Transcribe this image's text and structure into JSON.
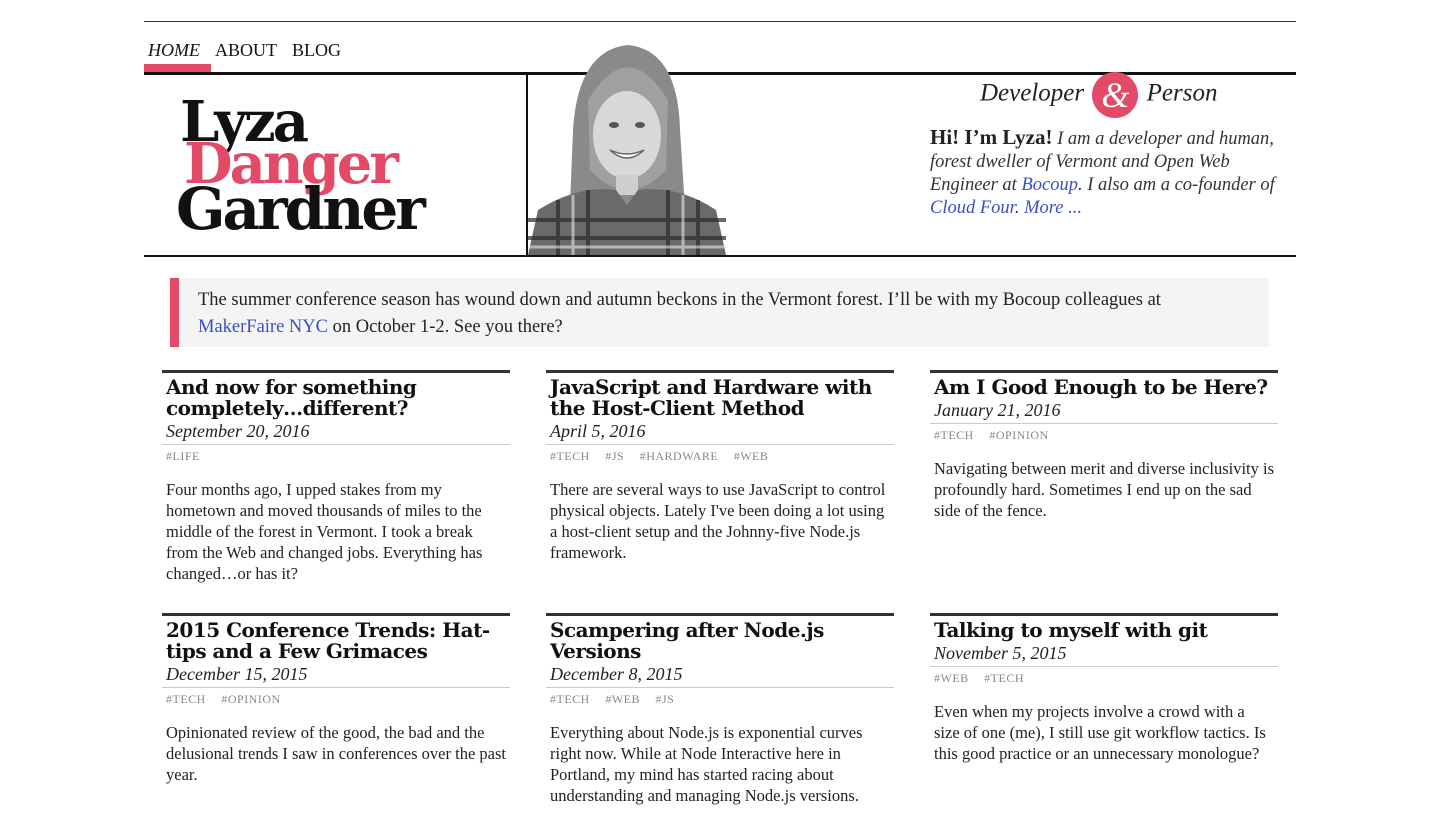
{
  "nav": {
    "items": [
      {
        "label": "HOME",
        "active": true
      },
      {
        "label": "ABOUT"
      },
      {
        "label": "BLOG"
      }
    ]
  },
  "logo": {
    "line1": "Lyza",
    "line2": "Danger",
    "line3": "Gardner"
  },
  "tagline": {
    "left": "Developer",
    "amp": "&",
    "right": "Person"
  },
  "intro": {
    "hi": "Hi! I’m Lyza!",
    "text1": "I am a developer and human, forest dweller of Vermont and Open Web Engineer at",
    "link1": "Bocoup",
    "text2": ". I also am a co-founder of",
    "link2": "Cloud Four",
    "text3": ".",
    "more": "More ..."
  },
  "notice": {
    "text1": "The summer conference season has wound down and autumn beckons in the Vermont forest. I’ll be with my Bocoup colleagues at",
    "link": "MakerFaire NYC",
    "text2": "on October 1-2. See you there?"
  },
  "posts": [
    {
      "title": "And now for something completely…different?",
      "date": "September 20, 2016",
      "tags": [
        "#LIFE"
      ],
      "excerpt": "Four months ago, I upped stakes from my hometown and moved thousands of miles to the middle of the forest in Vermont. I took a break from the Web and changed jobs. Everything has changed…or has it?"
    },
    {
      "title": "JavaScript and Hardware with the Host-Client Method",
      "date": "April 5, 2016",
      "tags": [
        "#TECH",
        "#JS",
        "#HARDWARE",
        "#WEB"
      ],
      "excerpt": "There are several ways to use JavaScript to control physical objects. Lately I've been doing a lot using a host-client setup and the Johnny-five Node.js framework."
    },
    {
      "title": "Am I Good Enough to be Here?",
      "date": "January 21, 2016",
      "tags": [
        "#TECH",
        "#OPINION"
      ],
      "excerpt": "Navigating between merit and diverse inclusivity is profoundly hard. Sometimes I end up on the sad side of the fence."
    },
    {
      "title": "2015 Conference Trends: Hat-tips and a Few Grimaces",
      "date": "December 15, 2015",
      "tags": [
        "#TECH",
        "#OPINION"
      ],
      "excerpt": "Opinionated review of the good, the bad and the delusional trends I saw in conferences over the past year."
    },
    {
      "title": "Scampering after Node.js Versions",
      "date": "December 8, 2015",
      "tags": [
        "#TECH",
        "#WEB",
        "#JS"
      ],
      "excerpt": "Everything about Node.js is exponential curves right now. While at Node Interactive here in Portland, my mind has started racing about understanding and managing Node.js versions."
    },
    {
      "title": "Talking to myself with git",
      "date": "November 5, 2015",
      "tags": [
        "#WEB",
        "#TECH"
      ],
      "excerpt": "Even when my projects involve a crowd with a size of one (me), I still use git workflow tactics. Is this good practice or an unnecessary monologue?"
    }
  ],
  "colors": {
    "accent": "#e24a68",
    "link": "#3a4fc4"
  }
}
